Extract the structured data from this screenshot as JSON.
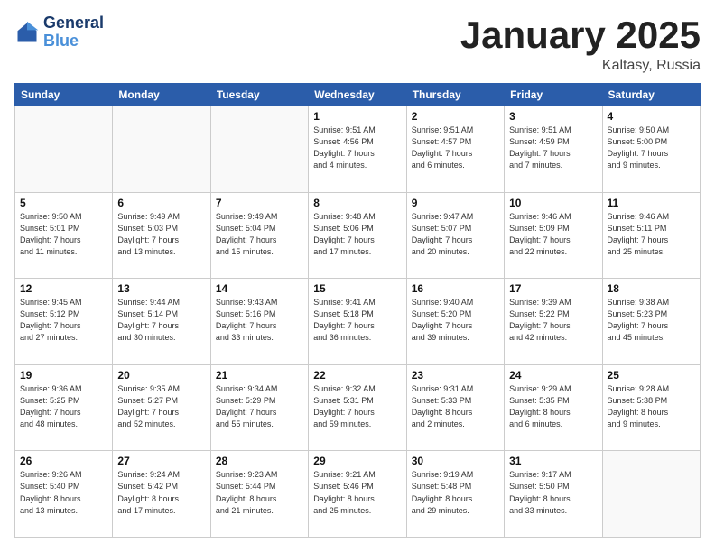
{
  "header": {
    "logo_line1": "General",
    "logo_line2": "Blue",
    "month": "January 2025",
    "location": "Kaltasy, Russia"
  },
  "days_of_week": [
    "Sunday",
    "Monday",
    "Tuesday",
    "Wednesday",
    "Thursday",
    "Friday",
    "Saturday"
  ],
  "weeks": [
    [
      {
        "day": "",
        "info": ""
      },
      {
        "day": "",
        "info": ""
      },
      {
        "day": "",
        "info": ""
      },
      {
        "day": "1",
        "info": "Sunrise: 9:51 AM\nSunset: 4:56 PM\nDaylight: 7 hours\nand 4 minutes."
      },
      {
        "day": "2",
        "info": "Sunrise: 9:51 AM\nSunset: 4:57 PM\nDaylight: 7 hours\nand 6 minutes."
      },
      {
        "day": "3",
        "info": "Sunrise: 9:51 AM\nSunset: 4:59 PM\nDaylight: 7 hours\nand 7 minutes."
      },
      {
        "day": "4",
        "info": "Sunrise: 9:50 AM\nSunset: 5:00 PM\nDaylight: 7 hours\nand 9 minutes."
      }
    ],
    [
      {
        "day": "5",
        "info": "Sunrise: 9:50 AM\nSunset: 5:01 PM\nDaylight: 7 hours\nand 11 minutes."
      },
      {
        "day": "6",
        "info": "Sunrise: 9:49 AM\nSunset: 5:03 PM\nDaylight: 7 hours\nand 13 minutes."
      },
      {
        "day": "7",
        "info": "Sunrise: 9:49 AM\nSunset: 5:04 PM\nDaylight: 7 hours\nand 15 minutes."
      },
      {
        "day": "8",
        "info": "Sunrise: 9:48 AM\nSunset: 5:06 PM\nDaylight: 7 hours\nand 17 minutes."
      },
      {
        "day": "9",
        "info": "Sunrise: 9:47 AM\nSunset: 5:07 PM\nDaylight: 7 hours\nand 20 minutes."
      },
      {
        "day": "10",
        "info": "Sunrise: 9:46 AM\nSunset: 5:09 PM\nDaylight: 7 hours\nand 22 minutes."
      },
      {
        "day": "11",
        "info": "Sunrise: 9:46 AM\nSunset: 5:11 PM\nDaylight: 7 hours\nand 25 minutes."
      }
    ],
    [
      {
        "day": "12",
        "info": "Sunrise: 9:45 AM\nSunset: 5:12 PM\nDaylight: 7 hours\nand 27 minutes."
      },
      {
        "day": "13",
        "info": "Sunrise: 9:44 AM\nSunset: 5:14 PM\nDaylight: 7 hours\nand 30 minutes."
      },
      {
        "day": "14",
        "info": "Sunrise: 9:43 AM\nSunset: 5:16 PM\nDaylight: 7 hours\nand 33 minutes."
      },
      {
        "day": "15",
        "info": "Sunrise: 9:41 AM\nSunset: 5:18 PM\nDaylight: 7 hours\nand 36 minutes."
      },
      {
        "day": "16",
        "info": "Sunrise: 9:40 AM\nSunset: 5:20 PM\nDaylight: 7 hours\nand 39 minutes."
      },
      {
        "day": "17",
        "info": "Sunrise: 9:39 AM\nSunset: 5:22 PM\nDaylight: 7 hours\nand 42 minutes."
      },
      {
        "day": "18",
        "info": "Sunrise: 9:38 AM\nSunset: 5:23 PM\nDaylight: 7 hours\nand 45 minutes."
      }
    ],
    [
      {
        "day": "19",
        "info": "Sunrise: 9:36 AM\nSunset: 5:25 PM\nDaylight: 7 hours\nand 48 minutes."
      },
      {
        "day": "20",
        "info": "Sunrise: 9:35 AM\nSunset: 5:27 PM\nDaylight: 7 hours\nand 52 minutes."
      },
      {
        "day": "21",
        "info": "Sunrise: 9:34 AM\nSunset: 5:29 PM\nDaylight: 7 hours\nand 55 minutes."
      },
      {
        "day": "22",
        "info": "Sunrise: 9:32 AM\nSunset: 5:31 PM\nDaylight: 7 hours\nand 59 minutes."
      },
      {
        "day": "23",
        "info": "Sunrise: 9:31 AM\nSunset: 5:33 PM\nDaylight: 8 hours\nand 2 minutes."
      },
      {
        "day": "24",
        "info": "Sunrise: 9:29 AM\nSunset: 5:35 PM\nDaylight: 8 hours\nand 6 minutes."
      },
      {
        "day": "25",
        "info": "Sunrise: 9:28 AM\nSunset: 5:38 PM\nDaylight: 8 hours\nand 9 minutes."
      }
    ],
    [
      {
        "day": "26",
        "info": "Sunrise: 9:26 AM\nSunset: 5:40 PM\nDaylight: 8 hours\nand 13 minutes."
      },
      {
        "day": "27",
        "info": "Sunrise: 9:24 AM\nSunset: 5:42 PM\nDaylight: 8 hours\nand 17 minutes."
      },
      {
        "day": "28",
        "info": "Sunrise: 9:23 AM\nSunset: 5:44 PM\nDaylight: 8 hours\nand 21 minutes."
      },
      {
        "day": "29",
        "info": "Sunrise: 9:21 AM\nSunset: 5:46 PM\nDaylight: 8 hours\nand 25 minutes."
      },
      {
        "day": "30",
        "info": "Sunrise: 9:19 AM\nSunset: 5:48 PM\nDaylight: 8 hours\nand 29 minutes."
      },
      {
        "day": "31",
        "info": "Sunrise: 9:17 AM\nSunset: 5:50 PM\nDaylight: 8 hours\nand 33 minutes."
      },
      {
        "day": "",
        "info": ""
      }
    ]
  ]
}
